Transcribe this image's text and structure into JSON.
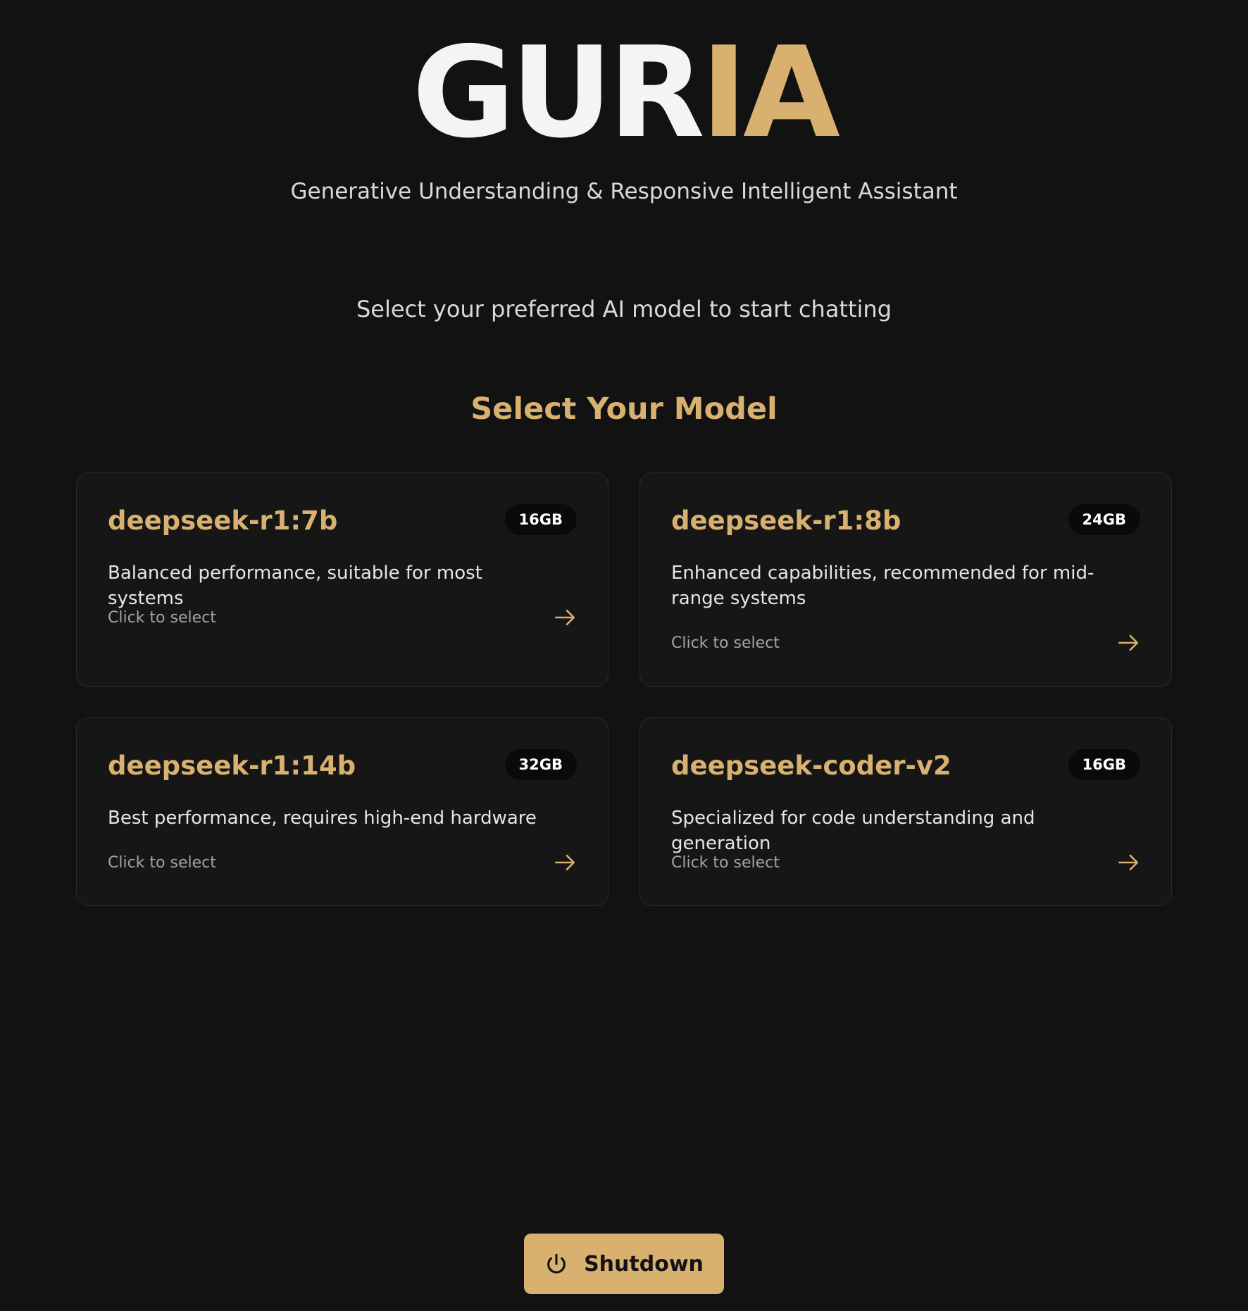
{
  "app": {
    "logo_part1": "GUR",
    "logo_part2": "IA",
    "subtitle": "Generative Understanding & Responsive Intelligent Assistant"
  },
  "main": {
    "prompt": "Select your preferred AI model to start chatting",
    "section_title": "Select Your Model",
    "models": [
      {
        "name": "deepseek-r1:7b",
        "size": "16GB",
        "description": "Balanced performance, suitable for most systems",
        "hint": "Click to select",
        "icon": "arrow-right-icon"
      },
      {
        "name": "deepseek-r1:8b",
        "size": "24GB",
        "description": "Enhanced capabilities, recommended for mid-range systems",
        "hint": "Click to select",
        "icon": "arrow-right-icon"
      },
      {
        "name": "deepseek-r1:14b",
        "size": "32GB",
        "description": "Best performance, requires high-end hardware",
        "hint": "Click to select",
        "icon": "arrow-right-icon"
      },
      {
        "name": "deepseek-coder-v2",
        "size": "16GB",
        "description": "Specialized for code understanding and generation",
        "hint": "Click to select",
        "icon": "arrow-right-icon"
      }
    ]
  },
  "footer": {
    "shutdown_label": "Shutdown",
    "shutdown_icon": "power-icon"
  },
  "colors": {
    "background": "#121212",
    "card_background": "#161616",
    "card_border": "#2a2a2a",
    "accent": "#d8b06f",
    "logo_white": "#f3f4f6",
    "badge_background": "#0a0a0a",
    "muted_text": "#a3a3a3"
  }
}
